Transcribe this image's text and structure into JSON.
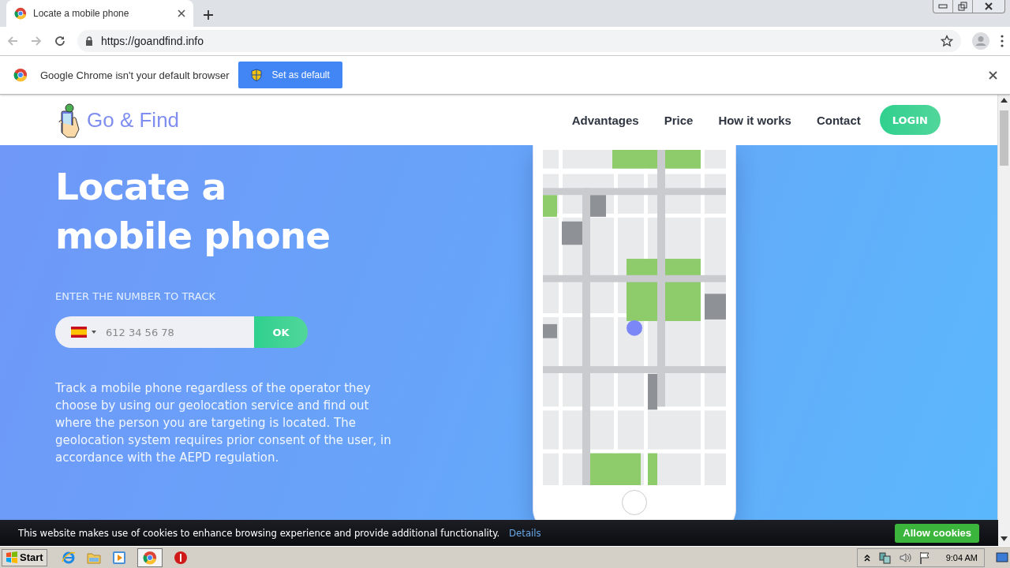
{
  "browser": {
    "tab": {
      "title": "Locate a mobile phone"
    },
    "address": "https://goandfind.info"
  },
  "infobar": {
    "message": "Google Chrome isn't your default browser",
    "button": "Set as default"
  },
  "site": {
    "logo": "Go & Find",
    "nav": [
      {
        "label": "Advantages"
      },
      {
        "label": "Price"
      },
      {
        "label": "How it works"
      },
      {
        "label": "Contact"
      }
    ],
    "login": "LOGIN"
  },
  "hero": {
    "title": "Locate a mobile phone",
    "prompt": "ENTER THE NUMBER TO TRACK",
    "placeholder": "612 34 56 78",
    "submit": "OK",
    "description": "Track a mobile phone regardless of the operator they choose by using our geolocation service and find out where the person you are targeting is located. The geolocation system requires prior consent of the user, in accordance with the AEPD regulation."
  },
  "cookies": {
    "message": "This website makes use of cookies to enhance browsing experience and provide additional functionality.",
    "link": "Details",
    "button": "Allow cookies"
  },
  "taskbar": {
    "start": "Start",
    "clock": "9:04 AM"
  }
}
